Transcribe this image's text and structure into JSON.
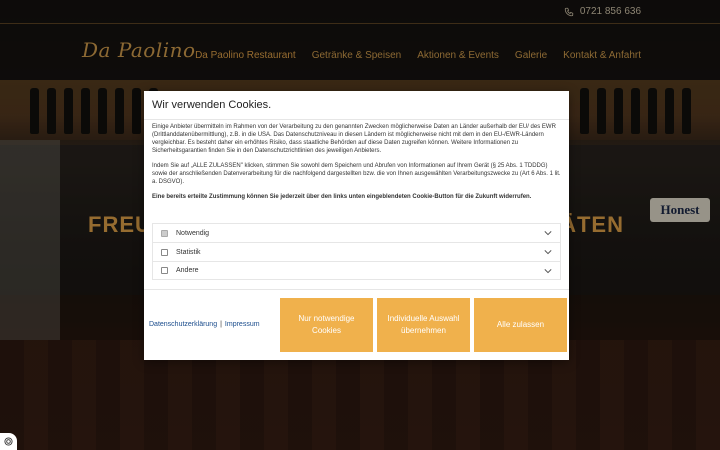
{
  "header": {
    "phone": "0721 856 636",
    "logo": "Da Paolino",
    "nav": [
      {
        "label": "Da Paolino Restaurant",
        "active": true
      },
      {
        "label": "Getränke & Speisen"
      },
      {
        "label": "Aktionen & Events"
      },
      {
        "label": "Galerie"
      },
      {
        "label": "Kontakt & Anfahrt"
      }
    ]
  },
  "hero": {
    "heading_left": "FREU",
    "heading_right": "ÄTEN",
    "sign": "Honest"
  },
  "cookie": {
    "title": "Wir verwenden Cookies.",
    "paragraph1": "Einige Anbieter übermitteln im Rahmen von der Verarbeitung zu den genannten Zwecken möglicherweise Daten an Länder außerhalb der EU/ des EWR (Drittlanddatenübermittlung), z.B. in die USA. Das Datenschutzniveau in diesen Ländern ist möglicherweise nicht mit dem in den EU-/EWR-Ländern vergleichbar. Es besteht daher ein erhöhtes Risiko, dass staatliche Behörden auf diese Daten zugreifen können. Weitere Informationen zu Sicherheitsgarantien finden Sie in den Datenschutzrichtlinien des jeweiligen Anbieters.",
    "paragraph2": "Indem Sie auf „ALLE ZULASSEN\" klicken, stimmen Sie sowohl dem Speichern und Abrufen von Informationen auf Ihrem Gerät (§ 25 Abs. 1 TDDDG) sowie der anschließenden Datenverarbeitung für die nachfolgend dargestellten bzw. die von Ihnen ausgewählten Verarbeitungszwecke zu (Art 6 Abs. 1 lit. a. DSGVO).",
    "paragraph3": "Eine bereits erteilte Zustimmung können Sie jederzeit über den links unten eingeblendeten Cookie-Button für die Zukunft widerrufen.",
    "options": [
      {
        "label": "Notwendig",
        "checked": true,
        "disabled": true
      },
      {
        "label": "Statistik",
        "checked": false
      },
      {
        "label": "Andere",
        "checked": false
      }
    ],
    "links": {
      "privacy": "Datenschutzerklärung",
      "separator": "|",
      "imprint": "Impressum"
    },
    "buttons": {
      "necessary": "Nur notwendige Cookies",
      "individual": "Individuelle Auswahl übernehmen",
      "all": "Alle zulassen"
    }
  },
  "colors": {
    "accent": "#f0b14c",
    "gold": "#d7a24f",
    "link": "#1a4c8c"
  },
  "icons": {
    "phone": "phone-icon",
    "chevron": "chevron-down-icon",
    "privacy": "fingerprint-icon"
  }
}
